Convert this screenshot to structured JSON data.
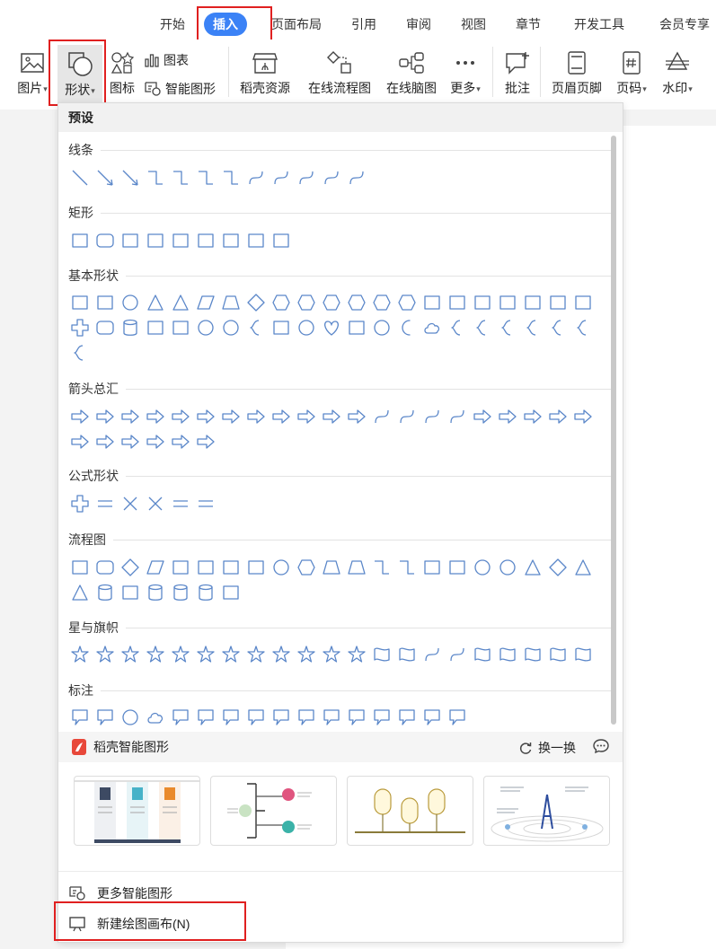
{
  "ribbon_tabs": [
    "开始",
    "插入",
    "页面布局",
    "引用",
    "审阅",
    "视图",
    "章节",
    "开发工具",
    "会员专享"
  ],
  "active_tab": "插入",
  "toolbar": {
    "picture": "图片",
    "shape": "形状",
    "icon": "图标",
    "chart": "图表",
    "smart_art": "智能图形",
    "docer_resource": "稻壳资源",
    "online_flowchart": "在线流程图",
    "online_mindmap": "在线脑图",
    "more": "更多",
    "comment": "批注",
    "header_footer": "页眉页脚",
    "page_number": "页码",
    "watermark": "水印"
  },
  "panel": {
    "header": "预设",
    "sections": [
      {
        "title": "线条",
        "icons": [
          "line",
          "arrow-line",
          "double-arrow-line",
          "elbow-connector",
          "elbow-arrow",
          "elbow-double-arrow",
          "curved-connector",
          "curved-arrow",
          "curved-double-arrow",
          "curve",
          "freeform",
          "scribble"
        ]
      },
      {
        "title": "矩形",
        "icons": [
          "rectangle",
          "rounded-rectangle",
          "snip-corner-rectangle",
          "snip-same-side-rectangle",
          "snip-diagonal-rectangle",
          "snip-round-rectangle",
          "round-single-corner-rectangle",
          "round-same-side-rectangle",
          "round-diagonal-rectangle"
        ]
      },
      {
        "title": "基本形状",
        "icons": [
          "text-box",
          "vertical-text-box",
          "oval",
          "triangle",
          "right-triangle",
          "parallelogram",
          "trapezoid",
          "diamond",
          "pentagon",
          "hexagon",
          "heptagon",
          "octagon",
          "decagon",
          "dodecagon",
          "pie",
          "teardrop",
          "chord",
          "frame",
          "half-frame",
          "l-shape",
          "diagonal-stripe",
          "plus",
          "plaque",
          "can",
          "cube",
          "bevel",
          "donut",
          "no-symbol",
          "block-arc",
          "folded-corner",
          "smiley-face",
          "heart",
          "lightning-bolt",
          "sun",
          "moon",
          "cloud",
          "arc",
          "double-bracket",
          "double-brace",
          "left-bracket",
          "right-bracket",
          "left-brace",
          "right-brace"
        ]
      },
      {
        "title": "箭头总汇",
        "icons": [
          "right-arrow",
          "left-arrow",
          "up-arrow",
          "down-arrow",
          "left-right-arrow",
          "up-down-arrow",
          "quad-arrow",
          "left-right-up-arrow",
          "bent-arrow",
          "u-turn-arrow",
          "left-up-arrow",
          "bent-up-arrow",
          "curved-right-arrow",
          "curved-left-arrow",
          "curved-up-arrow",
          "curved-down-arrow",
          "striped-right-arrow",
          "notched-right-arrow",
          "pentagon-arrow",
          "chevron",
          "right-arrow-callout",
          "left-arrow-callout",
          "up-arrow-callout",
          "down-arrow-callout",
          "left-right-arrow-callout",
          "quad-arrow-callout",
          "circular-arrow"
        ]
      },
      {
        "title": "公式形状",
        "icons": [
          "plus-sign",
          "minus-sign",
          "multiply-sign",
          "division-sign",
          "equal-sign",
          "not-equal-sign"
        ]
      },
      {
        "title": "流程图",
        "icons": [
          "process",
          "alternate-process",
          "decision",
          "data",
          "predefined-process",
          "internal-storage",
          "document",
          "multidocument",
          "terminator",
          "preparation",
          "manual-input",
          "manual-operation",
          "connector",
          "off-page-connector",
          "card",
          "punched-tape",
          "summing-junction",
          "or",
          "collate",
          "sort",
          "extract",
          "merge",
          "stored-data",
          "delay",
          "sequential-access-storage",
          "magnetic-disk",
          "direct-access-storage",
          "display"
        ]
      },
      {
        "title": "星与旗帜",
        "icons": [
          "explosion",
          "star-4-point",
          "star-4-point-thin",
          "star-5-point",
          "star-6-point",
          "star-7-point",
          "star-8-point",
          "star-10-point",
          "star-12-point",
          "star-16-point",
          "star-24-point",
          "star-32-point",
          "ribbon-up",
          "ribbon-down",
          "curved-ribbon-up",
          "curved-ribbon-down",
          "vertical-scroll",
          "horizontal-scroll",
          "wave",
          "double-wave",
          "banner"
        ]
      },
      {
        "title": "标注",
        "icons": [
          "rect-callout",
          "rounded-rect-callout",
          "oval-callout",
          "cloud-callout",
          "line-callout-1",
          "line-callout-2",
          "line-callout-3",
          "line-callout-1-accent",
          "line-callout-2-accent",
          "line-callout-3-accent",
          "line-callout-1-no-border",
          "line-callout-2-no-border",
          "line-callout-3-no-border",
          "line-callout-1-border-accent",
          "line-callout-2-border-accent",
          "line-callout-3-border-accent"
        ]
      }
    ],
    "smart_section": {
      "title": "稻壳智能图形",
      "swap_label": "换一换"
    },
    "more_smart": "更多智能图形",
    "new_canvas": "新建绘图画布(N)"
  },
  "colors": {
    "accent": "#3b82f6",
    "shape_stroke": "#5b87c9",
    "highlight": "#e02020"
  }
}
